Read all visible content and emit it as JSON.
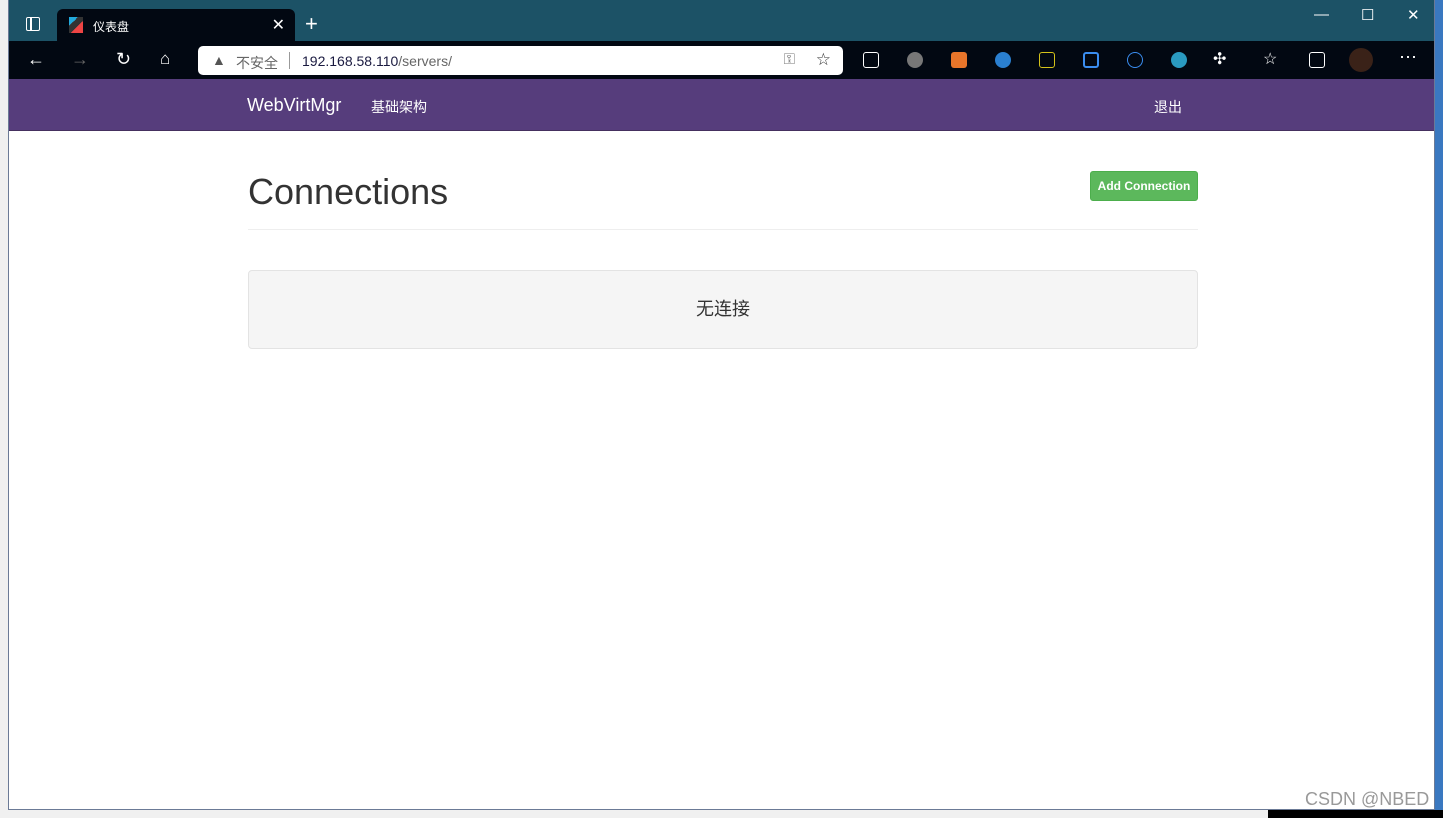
{
  "browser": {
    "tab_title": "仪表盘",
    "not_secure": "不安全",
    "url_host": "192.168.58.110",
    "url_path": "/servers/"
  },
  "navbar": {
    "brand": "WebVirtMgr",
    "nav_item": "基础架构",
    "logout": "退出",
    "color": "#563d7c"
  },
  "page": {
    "title": "Connections",
    "add_button": "Add Connection",
    "empty_message": "无连接",
    "button_color": "#5cb85c"
  },
  "watermark": "CSDN @NBED"
}
